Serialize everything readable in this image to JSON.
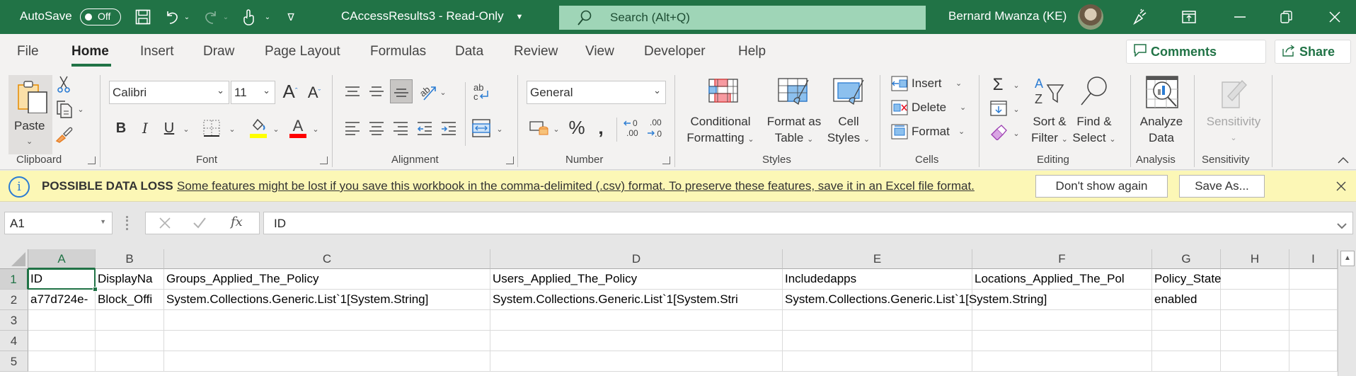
{
  "titlebar": {
    "autosave_label": "AutoSave",
    "autosave_state": "Off",
    "doc_title": "CAccessResults3  -  Read-Only",
    "search_placeholder": "Search (Alt+Q)",
    "user_name": "Bernard Mwanza (KE)",
    "icons": [
      "save-icon",
      "undo-icon",
      "redo-icon",
      "touch-mode-icon",
      "customize-qat-icon",
      "search-icon",
      "avatar",
      "coauthoring-icon",
      "ribbon-display-icon",
      "minimize-icon",
      "restore-icon",
      "close-icon"
    ]
  },
  "tabs": {
    "items": [
      "File",
      "Home",
      "Insert",
      "Draw",
      "Page Layout",
      "Formulas",
      "Data",
      "Review",
      "View",
      "Developer",
      "Help"
    ],
    "active": "Home",
    "comments_label": "Comments",
    "share_label": "Share"
  },
  "ribbon": {
    "clipboard": {
      "label": "Clipboard",
      "paste": "Paste"
    },
    "font": {
      "label": "Font",
      "font_name": "Calibri",
      "font_size": "11",
      "bold": "B",
      "italic": "I",
      "underline": "U",
      "fill_color": "#ffff00",
      "font_color": "#ff0000"
    },
    "alignment": {
      "label": "Alignment"
    },
    "number": {
      "label": "Number",
      "format": "General"
    },
    "styles": {
      "label": "Styles",
      "conditional_1": "Conditional",
      "conditional_2": "Formatting",
      "format_table_1": "Format as",
      "format_table_2": "Table",
      "cell_styles_1": "Cell",
      "cell_styles_2": "Styles"
    },
    "cells": {
      "label": "Cells",
      "insert": "Insert",
      "delete": "Delete",
      "format": "Format"
    },
    "editing": {
      "label": "Editing",
      "sort_1": "Sort &",
      "sort_2": "Filter",
      "find_1": "Find &",
      "find_2": "Select"
    },
    "analysis": {
      "label": "Analysis",
      "analyze_1": "Analyze",
      "analyze_2": "Data"
    },
    "sensitivity": {
      "label": "Sensitivity",
      "button": "Sensitivity"
    }
  },
  "banner": {
    "title": "POSSIBLE DATA LOSS",
    "message": "Some features might be lost if you save this workbook in the comma-delimited (.csv) format. To preserve these features, save it in an Excel file format.",
    "dont_show": "Don't show again",
    "save_as": "Save As..."
  },
  "formula_bar": {
    "name_box": "A1",
    "formula": "ID"
  },
  "sheet": {
    "columns": [
      "A",
      "B",
      "C",
      "D",
      "E",
      "F",
      "G",
      "H",
      "I"
    ],
    "row_numbers": [
      "1",
      "2",
      "3",
      "4",
      "5"
    ],
    "selected_cell": "A1",
    "rows": [
      [
        "ID",
        "DisplayNa",
        "Groups_Applied_The_Policy",
        "Users_Applied_The_Policy",
        "Includedapps",
        "Locations_Applied_The_Pol",
        "Policy_State",
        "",
        ""
      ],
      [
        "a77d724e-",
        "Block_Offi",
        "System.Collections.Generic.List`1[System.String]",
        "System.Collections.Generic.List`1[System.Stri",
        "System.Collections.Generic.List`1[System.String]",
        "",
        "enabled",
        "",
        ""
      ]
    ]
  },
  "colors": {
    "excel_green": "#217346",
    "banner_bg": "#fcf7b6",
    "search_bg": "#9fd5b7"
  }
}
